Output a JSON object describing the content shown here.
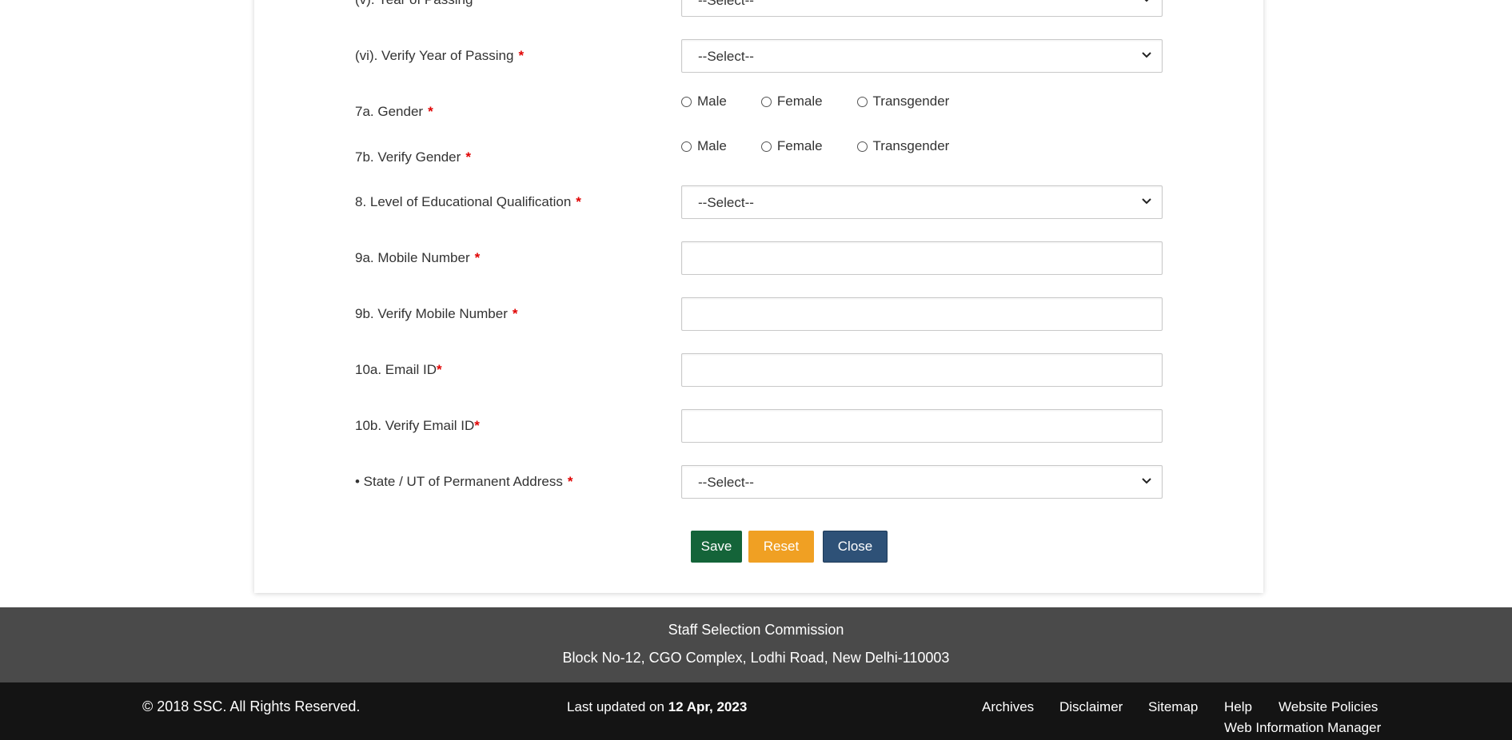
{
  "form": {
    "rows": [
      {
        "label": "(v). Year of Passing",
        "req": "*",
        "value": "--Select--"
      },
      {
        "label": "(vi). Verify Year of Passing",
        "req": "*",
        "value": "--Select--"
      },
      {
        "label": "7a. Gender",
        "req": "*",
        "options": [
          "Male",
          "Female",
          "Transgender"
        ]
      },
      {
        "label": "7b. Verify Gender",
        "req": "*",
        "options": [
          "Male",
          "Female",
          "Transgender"
        ]
      },
      {
        "label": "8. Level of Educational Qualification",
        "req": "*",
        "value": "--Select--"
      },
      {
        "label": "9a. Mobile Number",
        "req": "*",
        "value": ""
      },
      {
        "label": "9b. Verify Mobile Number",
        "req": "*",
        "value": ""
      },
      {
        "label": "10a. Email ID",
        "req": "*",
        "value": ""
      },
      {
        "label": "10b. Verify Email ID",
        "req": "*",
        "value": ""
      },
      {
        "label": "• State / UT of Permanent Address",
        "req": "*",
        "value": "--Select--"
      }
    ],
    "buttons": {
      "save": "Save",
      "reset": "Reset",
      "close": "Close"
    }
  },
  "footer": {
    "org": "Staff Selection Commission",
    "address": "Block No-12, CGO Complex, Lodhi Road, New Delhi-110003",
    "copyright": "© 2018 SSC. All Rights Reserved.",
    "last_updated_prefix": "Last updated on",
    "last_updated_date": "12 Apr, 2023",
    "links": [
      "Archives",
      "Disclaimer",
      "Sitemap",
      "Help",
      "Website Policies"
    ],
    "web_info_manager": "Web Information Manager"
  },
  "colors": {
    "save": "#146439",
    "reset": "#f0a023",
    "close": "#2e5177",
    "required": "#e00000",
    "footer_top": "#4a4a4a",
    "footer_bottom": "#141414"
  }
}
